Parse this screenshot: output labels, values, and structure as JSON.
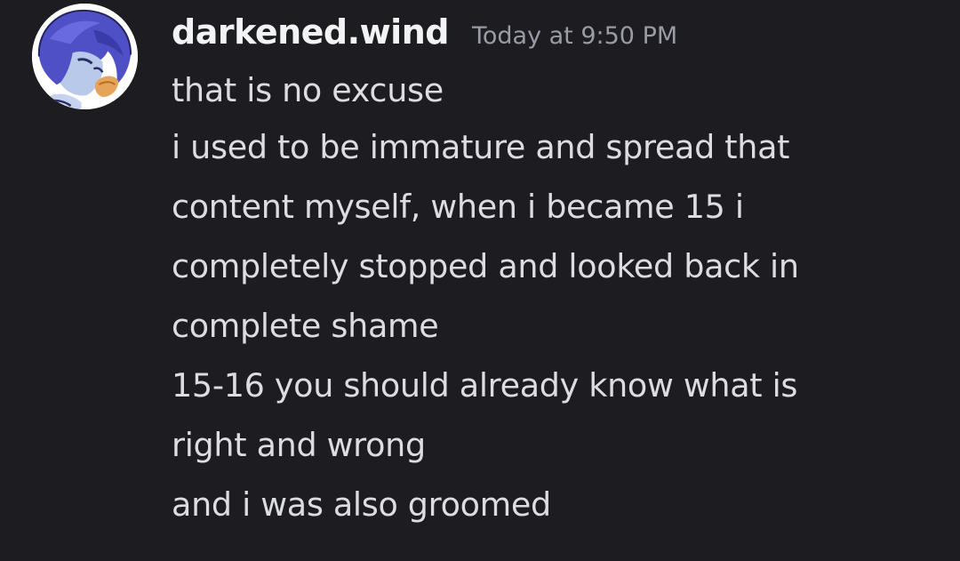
{
  "message": {
    "username": "darkened.wind",
    "timestamp": "Today at 9:50 PM",
    "avatar_icon": "anime-character-avatar",
    "lines": [
      "that is no excuse",
      "i used to be immature and spread that",
      "content myself, when i became 15 i",
      "completely stopped and looked back in",
      "complete shame",
      "15-16 you should already know what is",
      "right and wrong",
      "and i was also groomed"
    ]
  },
  "colors": {
    "background": "#1c1c21",
    "username": "#f2f3f5",
    "timestamp": "#9a9ca5",
    "text": "#dcdde2",
    "avatar_hair": "#4f4fc6"
  }
}
